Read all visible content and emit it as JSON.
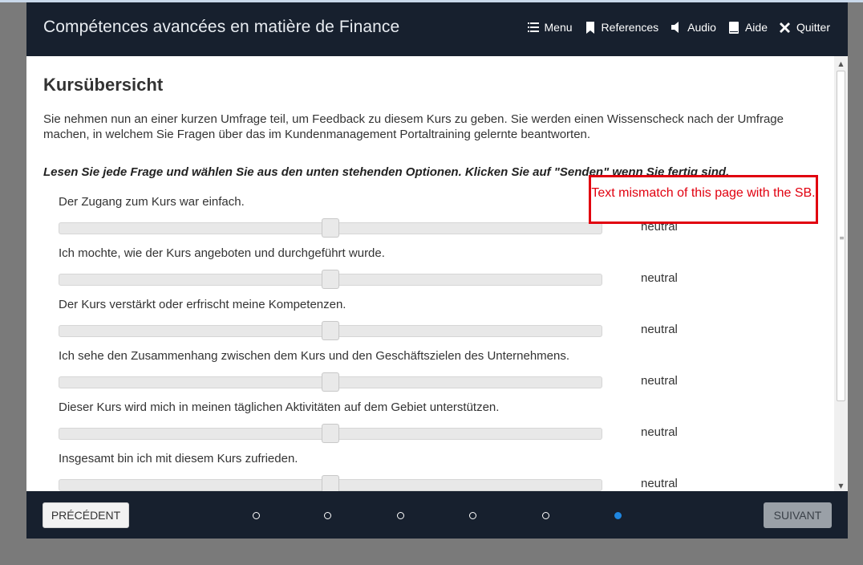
{
  "app": {
    "title": "Compétences avancées en matière de Finance"
  },
  "nav": {
    "menu": "Menu",
    "references": "References",
    "audio": "Audio",
    "help": "Aide",
    "quit": "Quitter"
  },
  "page": {
    "title": "Kursübersicht",
    "intro": "Sie nehmen nun an einer kurzen Umfrage teil, um Feedback zu diesem Kurs zu geben. Sie werden einen Wissenscheck nach der Umfrage machen, in welchem Sie Fragen über das im Kundenmanagement Portaltraining gelernte beantworten.",
    "instruction": "Lesen Sie jede Frage und wählen Sie aus den unten stehenden Optionen. Klicken Sie auf \"Senden\" wenn Sie fertig sind."
  },
  "questions": [
    {
      "label": "Der Zugang zum Kurs war einfach.",
      "value": "neutral",
      "level": 0.5
    },
    {
      "label": "Ich mochte, wie der Kurs angeboten und durchgeführt wurde.",
      "value": "neutral",
      "level": 0.5
    },
    {
      "label": "Der Kurs verstärkt oder erfrischt meine Kompetenzen.",
      "value": "neutral",
      "level": 0.5
    },
    {
      "label": "Ich sehe den Zusammenhang zwischen dem Kurs und den Geschäftszielen des Unternehmens.",
      "value": "neutral",
      "level": 0.5
    },
    {
      "label": "Dieser Kurs wird mich in meinen täglichen Aktivitäten auf dem Gebiet unterstützen.",
      "value": "neutral",
      "level": 0.5
    },
    {
      "label": "Insgesamt bin ich mit diesem Kurs zufrieden.",
      "value": "neutral",
      "level": 0.5
    }
  ],
  "annotation": {
    "text": "Text mismatch of this page with the SB."
  },
  "footer": {
    "prev": "PRÉCÉDENT",
    "next": "SUIVANT",
    "dots_total": 6,
    "dots_active": 6
  },
  "colors": {
    "header_bg": "#17202e",
    "annotation": "#e1000f",
    "dot_active": "#1f86e0"
  }
}
